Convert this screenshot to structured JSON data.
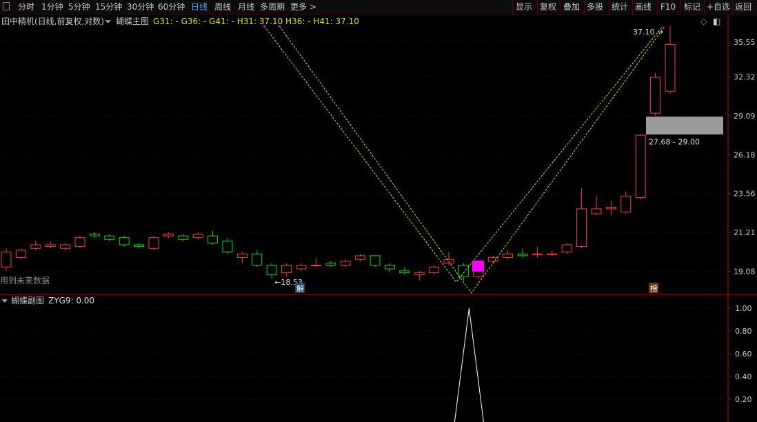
{
  "colors": {
    "up": "#ff3b3b",
    "down": "#00e000",
    "grid": "#3a0000",
    "axis": "#c00000",
    "zigzag": "#e6e600",
    "magenta": "#ff00ff",
    "gray_box": "#9a9a9a"
  },
  "toolbar": {
    "periods": [
      "分时",
      "1分钟",
      "5分钟",
      "15分钟",
      "30分钟",
      "60分钟",
      "日线",
      "周线",
      "月线",
      "多周期",
      "更多 >"
    ],
    "active_period": "日线",
    "right_buttons": [
      "显示",
      "复权",
      "叠加",
      "多股",
      "统计",
      "画线",
      "F10",
      "标记",
      "+自选",
      "返回"
    ]
  },
  "main_header": {
    "stock_title": "田中精机(日线,前复权,对数)",
    "indicator_name": "蝴蝶主图",
    "values_prefix": "G31: -  G36: -  G41: -",
    "values_suffix": "H31: 37.10  H36: -  H41: 37.10",
    "icons": [
      "dropdown-icon",
      "diamond-icon",
      "window-icon"
    ]
  },
  "main_annotations": {
    "future_data_note": "用到未来数据",
    "low_label": "←18.53",
    "high_label": "37.10",
    "range_label": "27.68 - 29.00",
    "marker_jie": "解",
    "marker_bang": "榜"
  },
  "main_axis": {
    "labels": [
      "35.55",
      "32.32",
      "29.09",
      "26.18",
      "23.56",
      "21.21",
      "19.08"
    ]
  },
  "sub_header": {
    "indicator_name": "蝴蝶副图",
    "values": "ZYG9: 0.00"
  },
  "sub_axis": {
    "labels": [
      "1.00",
      "0.80",
      "0.60",
      "0.40",
      "0.20"
    ]
  },
  "chart_data": {
    "type": "candlestick",
    "scale": "log",
    "candles": [
      {
        "o": 19.3,
        "c": 20.1,
        "h": 20.3,
        "l": 19.1
      },
      {
        "o": 19.8,
        "c": 20.2,
        "h": 20.3,
        "l": 19.7
      },
      {
        "o": 20.3,
        "c": 20.5,
        "h": 20.7,
        "l": 20.2
      },
      {
        "o": 20.4,
        "c": 20.5,
        "h": 20.7,
        "l": 20.3
      },
      {
        "o": 20.3,
        "c": 20.5,
        "h": 20.6,
        "l": 20.2
      },
      {
        "o": 20.4,
        "c": 20.9,
        "h": 21.0,
        "l": 20.3
      },
      {
        "o": 21.1,
        "c": 21.0,
        "h": 21.2,
        "l": 20.9
      },
      {
        "o": 21.0,
        "c": 20.8,
        "h": 21.1,
        "l": 20.7
      },
      {
        "o": 20.9,
        "c": 20.5,
        "h": 21.0,
        "l": 20.4
      },
      {
        "o": 20.5,
        "c": 20.4,
        "h": 20.6,
        "l": 20.3
      },
      {
        "o": 20.3,
        "c": 20.9,
        "h": 21.0,
        "l": 20.2
      },
      {
        "o": 21.0,
        "c": 21.1,
        "h": 21.2,
        "l": 20.9
      },
      {
        "o": 21.0,
        "c": 20.8,
        "h": 21.1,
        "l": 20.7
      },
      {
        "o": 20.9,
        "c": 21.1,
        "h": 21.2,
        "l": 20.8
      },
      {
        "o": 21.0,
        "c": 20.6,
        "h": 21.3,
        "l": 20.5
      },
      {
        "o": 20.7,
        "c": 20.1,
        "h": 20.9,
        "l": 20.0
      },
      {
        "o": 19.8,
        "c": 20.0,
        "h": 20.1,
        "l": 19.5
      },
      {
        "o": 20.0,
        "c": 19.4,
        "h": 20.2,
        "l": 19.3
      },
      {
        "o": 19.4,
        "c": 18.9,
        "h": 19.5,
        "l": 18.7
      },
      {
        "o": 19.0,
        "c": 19.4,
        "h": 19.5,
        "l": 18.8
      },
      {
        "o": 19.2,
        "c": 19.4,
        "h": 19.5,
        "l": 19.1
      },
      {
        "o": 19.4,
        "c": 19.4,
        "h": 19.8,
        "l": 19.3
      },
      {
        "o": 19.5,
        "c": 19.4,
        "h": 19.6,
        "l": 19.3
      },
      {
        "o": 19.4,
        "c": 19.6,
        "h": 19.7,
        "l": 19.3
      },
      {
        "o": 19.7,
        "c": 19.9,
        "h": 20.0,
        "l": 19.6
      },
      {
        "o": 19.9,
        "c": 19.4,
        "h": 19.9,
        "l": 19.3
      },
      {
        "o": 19.4,
        "c": 19.2,
        "h": 19.5,
        "l": 19.0
      },
      {
        "o": 19.1,
        "c": 19.0,
        "h": 19.3,
        "l": 18.9
      },
      {
        "o": 18.9,
        "c": 19.0,
        "h": 19.1,
        "l": 18.6
      },
      {
        "o": 19.0,
        "c": 19.3,
        "h": 19.4,
        "l": 18.9
      },
      {
        "o": 19.5,
        "c": 19.7,
        "h": 20.1,
        "l": 19.4
      },
      {
        "o": 19.4,
        "c": 18.8,
        "h": 19.5,
        "l": 18.6
      },
      {
        "o": 18.8,
        "c": 19.5,
        "h": 19.6,
        "l": 18.7
      },
      {
        "o": 19.6,
        "c": 19.8,
        "h": 19.9,
        "l": 19.5
      },
      {
        "o": 19.8,
        "c": 20.0,
        "h": 20.2,
        "l": 19.7
      },
      {
        "o": 20.0,
        "c": 19.9,
        "h": 20.3,
        "l": 19.8
      },
      {
        "o": 20.0,
        "c": 20.0,
        "h": 20.4,
        "l": 19.8
      },
      {
        "o": 20.0,
        "c": 20.0,
        "h": 20.2,
        "l": 19.9
      },
      {
        "o": 20.1,
        "c": 20.5,
        "h": 20.6,
        "l": 20.0
      },
      {
        "o": 20.4,
        "c": 22.6,
        "h": 23.9,
        "l": 20.3
      },
      {
        "o": 22.3,
        "c": 22.6,
        "h": 23.4,
        "l": 22.2
      },
      {
        "o": 22.6,
        "c": 22.7,
        "h": 23.1,
        "l": 22.2
      },
      {
        "o": 22.4,
        "c": 23.4,
        "h": 23.7,
        "l": 22.3
      },
      {
        "o": 23.3,
        "c": 27.6,
        "h": 27.7,
        "l": 23.2
      },
      {
        "o": 29.3,
        "c": 32.3,
        "h": 32.7,
        "l": 29.1
      },
      {
        "o": 31.1,
        "c": 35.3,
        "h": 37.1,
        "l": 30.9
      }
    ],
    "zigzag_pivots": [
      {
        "index": 17.5,
        "value": 37.1
      },
      {
        "index": 30.5,
        "value": 18.53
      },
      {
        "index": 44.5,
        "value": 37.1
      }
    ],
    "sub_indicator": {
      "name": "ZYG9",
      "value": 0.0,
      "peak_index": 31,
      "peak_value": 1.0
    }
  }
}
